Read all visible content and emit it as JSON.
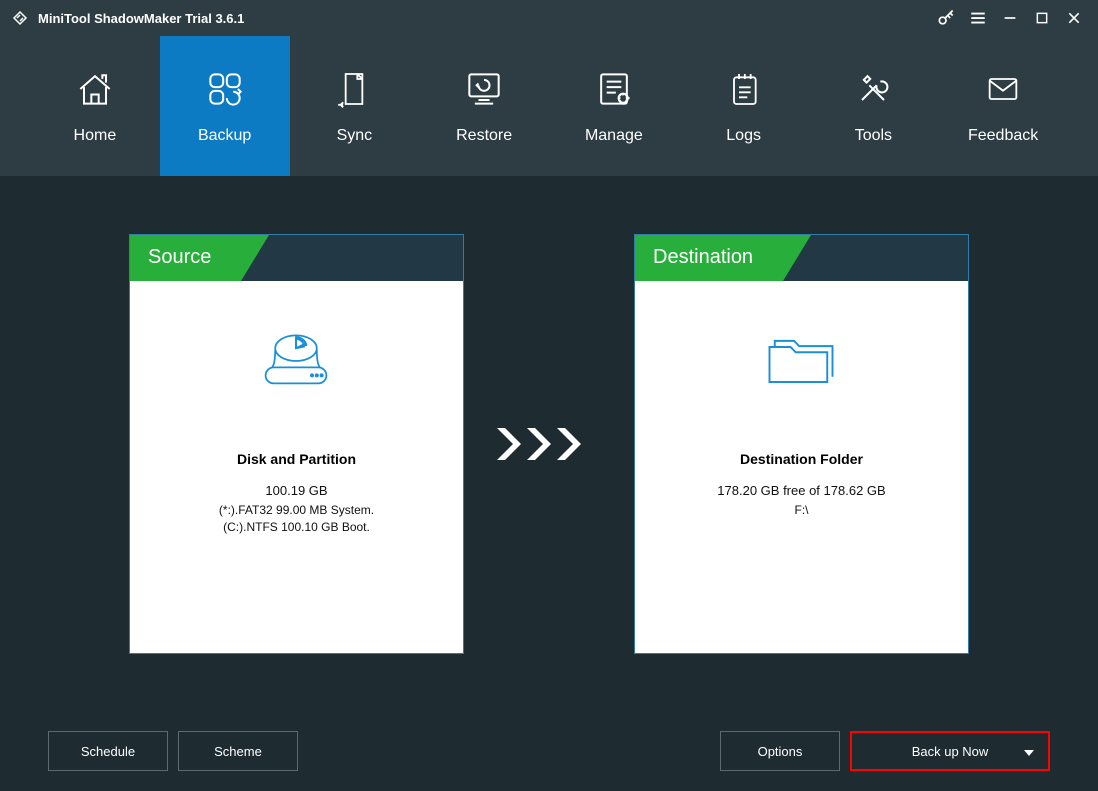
{
  "titlebar": {
    "title": "MiniTool ShadowMaker Trial 3.6.1"
  },
  "nav": {
    "items": [
      {
        "label": "Home"
      },
      {
        "label": "Backup"
      },
      {
        "label": "Sync"
      },
      {
        "label": "Restore"
      },
      {
        "label": "Manage"
      },
      {
        "label": "Logs"
      },
      {
        "label": "Tools"
      },
      {
        "label": "Feedback"
      }
    ]
  },
  "source_panel": {
    "header": "Source",
    "title": "Disk and Partition",
    "size": "100.19 GB",
    "line1": "(*:).FAT32 99.00 MB System.",
    "line2": "(C:).NTFS 100.10 GB Boot."
  },
  "destination_panel": {
    "header": "Destination",
    "title": "Destination Folder",
    "free": "178.20 GB free of 178.62 GB",
    "path": "F:\\"
  },
  "footer": {
    "schedule": "Schedule",
    "scheme": "Scheme",
    "options": "Options",
    "backup_now": "Back up Now"
  }
}
